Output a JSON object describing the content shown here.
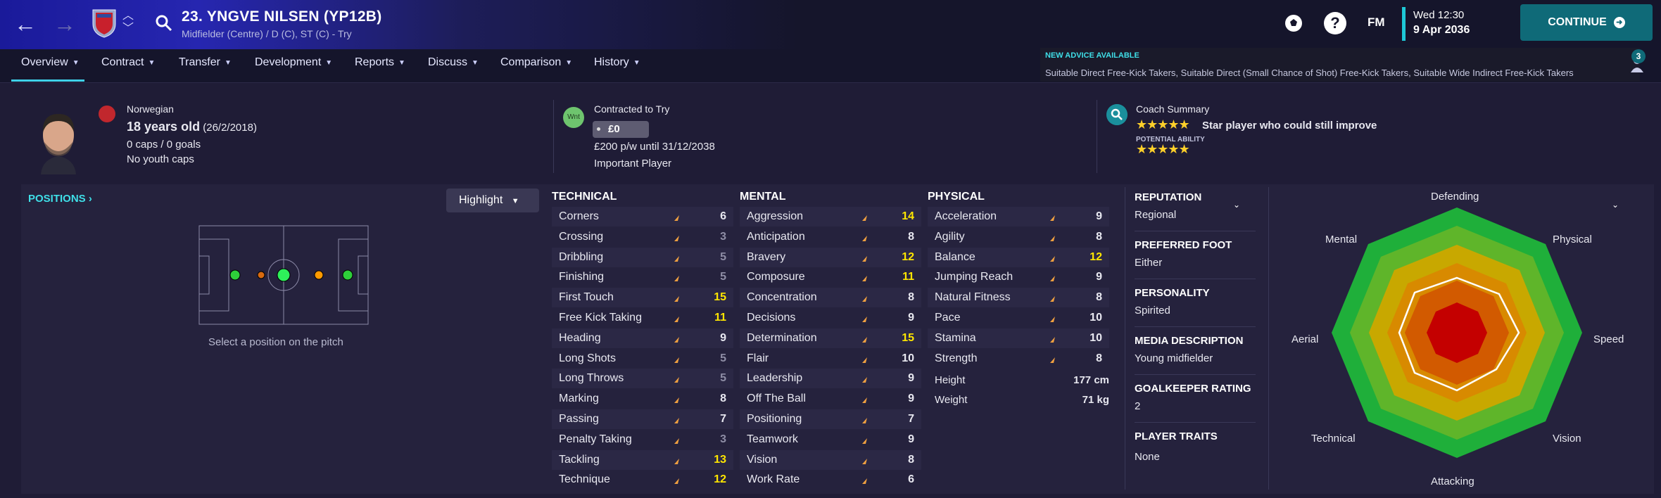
{
  "header": {
    "title": "23. YNGVE NILSEN (YP12B)",
    "subtitle": "Midfielder (Centre) / D (C), ST (C) - Try",
    "fm": "FM",
    "time": "Wed 12:30",
    "date": "9 Apr 2036",
    "continue": "CONTINUE",
    "help": "?"
  },
  "tabs": [
    {
      "label": "Overview"
    },
    {
      "label": "Contract"
    },
    {
      "label": "Transfer"
    },
    {
      "label": "Development"
    },
    {
      "label": "Reports"
    },
    {
      "label": "Discuss"
    },
    {
      "label": "Comparison"
    },
    {
      "label": "History"
    }
  ],
  "advice": {
    "title": "NEW ADVICE AVAILABLE",
    "text": "Suitable Direct Free-Kick Takers, Suitable Direct (Small Chance of Shot) Free-Kick Takers, Suitable Wide Indirect Free-Kick Takers",
    "badge": "3"
  },
  "profile": {
    "nationality": "Norwegian",
    "age": "18 years old",
    "dob": "(26/2/2018)",
    "caps": "0 caps / 0 goals",
    "youth": "No youth caps"
  },
  "contract": {
    "wnt": "Wnt",
    "title": "Contracted to Try",
    "value": "£0",
    "wage": "£200 p/w until 31/12/2038",
    "role": "Important Player"
  },
  "coach": {
    "title": "Coach Summary",
    "summary": "Star player who could still improve",
    "potential_label": "POTENTIAL ABILITY",
    "ability_stars": 5,
    "potential_stars": 5
  },
  "positions": {
    "title": "POSITIONS",
    "highlight": "Highlight",
    "caption": "Select a position on the pitch"
  },
  "attributes": {
    "technical": {
      "title": "TECHNICAL",
      "items": [
        [
          "Corners",
          "6"
        ],
        [
          "Crossing",
          "3"
        ],
        [
          "Dribbling",
          "5"
        ],
        [
          "Finishing",
          "5"
        ],
        [
          "First Touch",
          "15"
        ],
        [
          "Free Kick Taking",
          "11"
        ],
        [
          "Heading",
          "9"
        ],
        [
          "Long Shots",
          "5"
        ],
        [
          "Long Throws",
          "5"
        ],
        [
          "Marking",
          "8"
        ],
        [
          "Passing",
          "7"
        ],
        [
          "Penalty Taking",
          "3"
        ],
        [
          "Tackling",
          "13"
        ],
        [
          "Technique",
          "12"
        ]
      ]
    },
    "mental": {
      "title": "MENTAL",
      "items": [
        [
          "Aggression",
          "14"
        ],
        [
          "Anticipation",
          "8"
        ],
        [
          "Bravery",
          "12"
        ],
        [
          "Composure",
          "11"
        ],
        [
          "Concentration",
          "8"
        ],
        [
          "Decisions",
          "9"
        ],
        [
          "Determination",
          "15"
        ],
        [
          "Flair",
          "10"
        ],
        [
          "Leadership",
          "9"
        ],
        [
          "Off The Ball",
          "9"
        ],
        [
          "Positioning",
          "7"
        ],
        [
          "Teamwork",
          "9"
        ],
        [
          "Vision",
          "8"
        ],
        [
          "Work Rate",
          "6"
        ]
      ]
    },
    "physical": {
      "title": "PHYSICAL",
      "items": [
        [
          "Acceleration",
          "9"
        ],
        [
          "Agility",
          "8"
        ],
        [
          "Balance",
          "12"
        ],
        [
          "Jumping Reach",
          "9"
        ],
        [
          "Natural Fitness",
          "8"
        ],
        [
          "Pace",
          "10"
        ],
        [
          "Stamina",
          "10"
        ],
        [
          "Strength",
          "8"
        ]
      ],
      "height_label": "Height",
      "height": "177 cm",
      "weight_label": "Weight",
      "weight": "71 kg"
    }
  },
  "details": [
    {
      "label": "REPUTATION",
      "value": "Regional"
    },
    {
      "label": "PREFERRED FOOT",
      "value": "Either"
    },
    {
      "label": "PERSONALITY",
      "value": "Spirited"
    },
    {
      "label": "MEDIA DESCRIPTION",
      "value": "Young midfielder"
    },
    {
      "label": "GOALKEEPER RATING",
      "value": "2"
    },
    {
      "label": "PLAYER TRAITS",
      "value": "None"
    }
  ],
  "radar": {
    "labels": [
      "Defending",
      "Physical",
      "Speed",
      "Vision",
      "Attacking",
      "Technical",
      "Aerial",
      "Mental"
    ]
  },
  "colors": {
    "accent": "#3fdfe8",
    "highlight_value": "#ffe600",
    "arrow": "#f0a040"
  }
}
